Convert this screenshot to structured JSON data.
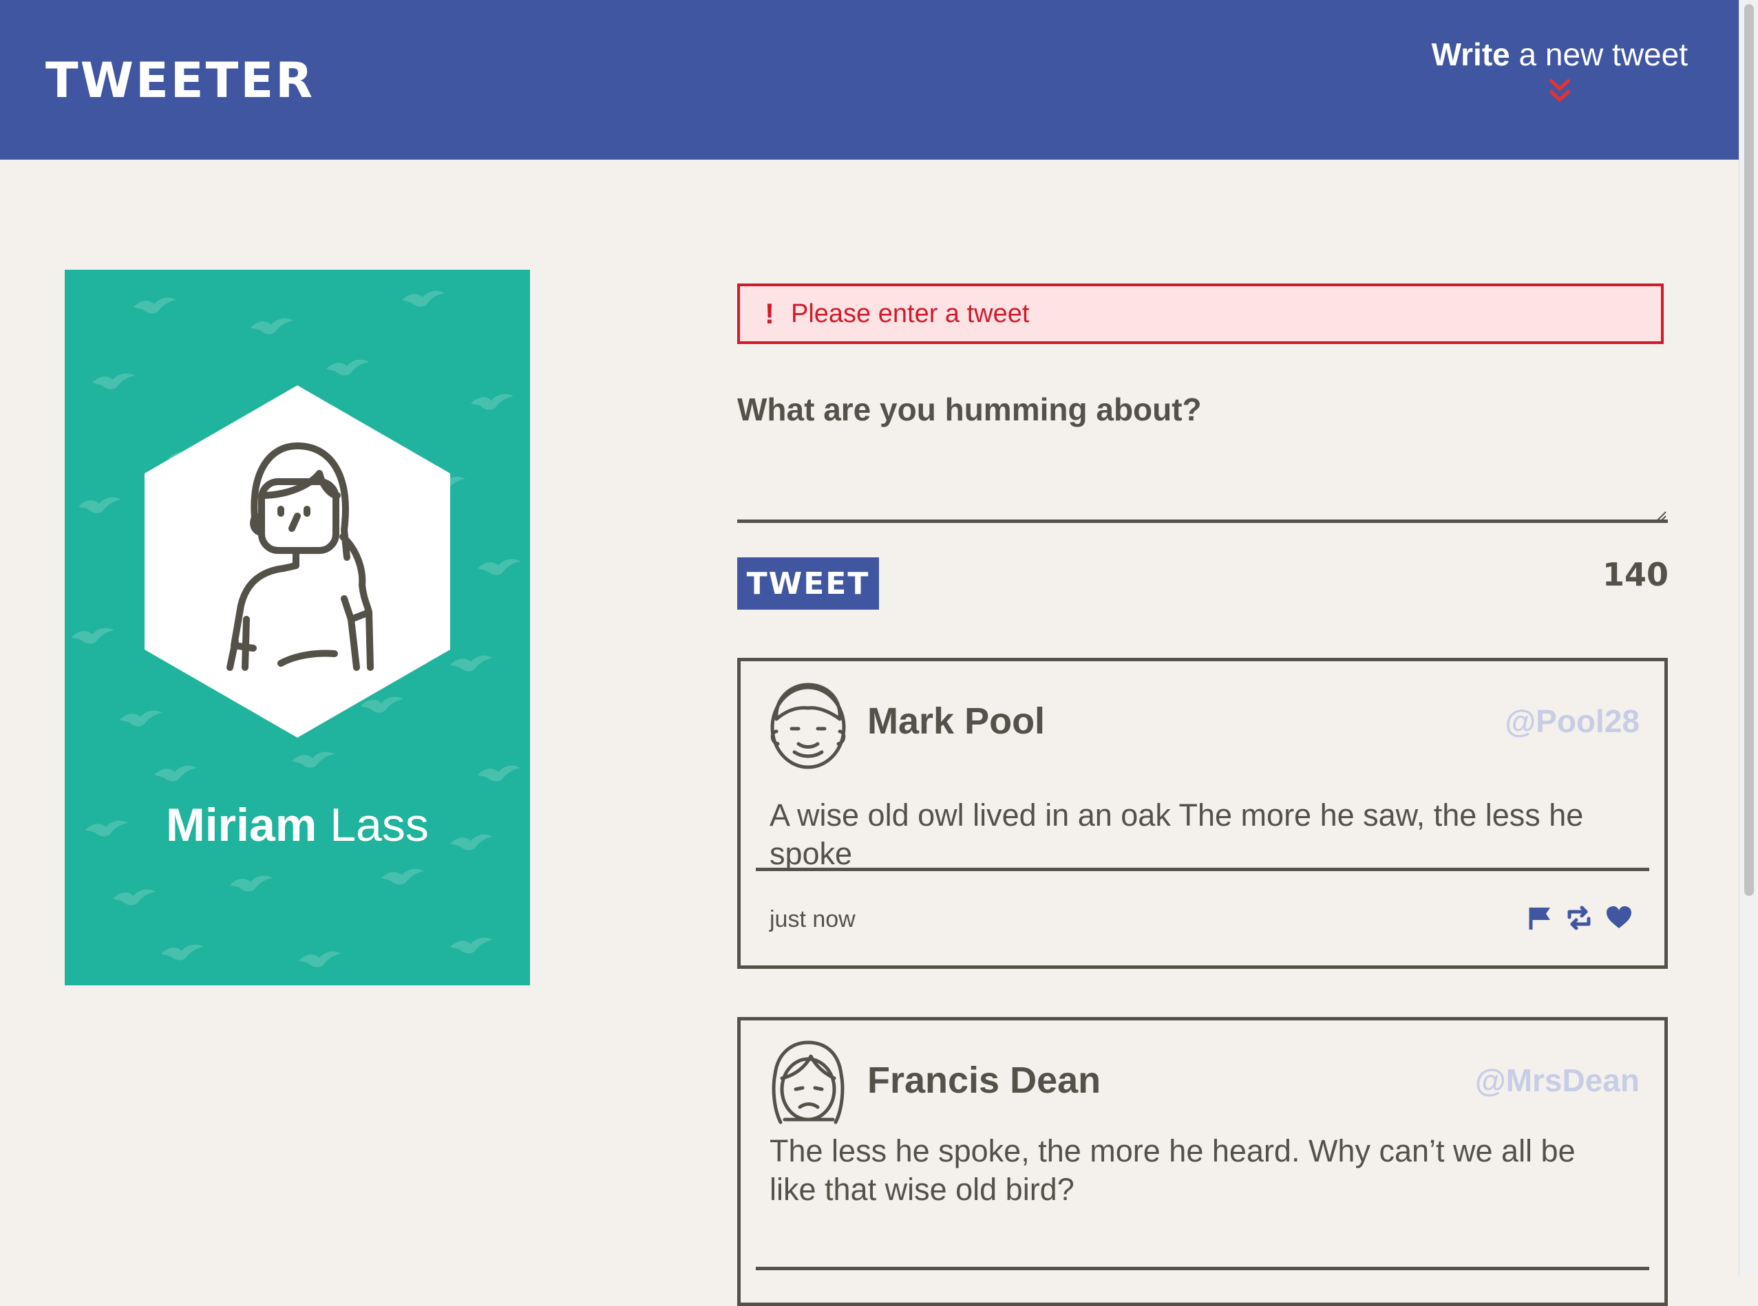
{
  "header": {
    "brand": "TWEETER",
    "compose_bold": "Write",
    "compose_rest": " a new tweet",
    "bg_color": "#4056a1"
  },
  "profile": {
    "first_name": "Miriam",
    "last_name": " Lass",
    "bg_color": "#20b39d",
    "avatar_icon": "woman-avatar-icon"
  },
  "composer": {
    "error_icon": "!",
    "error_text": "Please enter a tweet",
    "prompt": "What are you humming about?",
    "input_value": "",
    "submit_label": "TWEET",
    "char_counter": "140"
  },
  "tweets": [
    {
      "name": "Mark Pool",
      "handle": "@Pool28",
      "text": "A wise old owl lived in an oak The more he saw, the less he spoke",
      "time": "just now",
      "avatar_icon": "man-avatar-icon",
      "actions": [
        "flag-icon",
        "retweet-icon",
        "heart-icon"
      ]
    },
    {
      "name": "Francis Dean",
      "handle": "@MrsDean",
      "text": "The less he spoke, the more he heard. Why can’t we all be like that wise old bird?",
      "avatar_icon": "woman-avatar-icon"
    }
  ],
  "colors": {
    "accent": "#4056a1",
    "error": "#cf1b2b",
    "error_bg": "#fde3e3",
    "text": "#545149",
    "handle": "#c8cde6",
    "page_bg": "#f4f1ec"
  }
}
